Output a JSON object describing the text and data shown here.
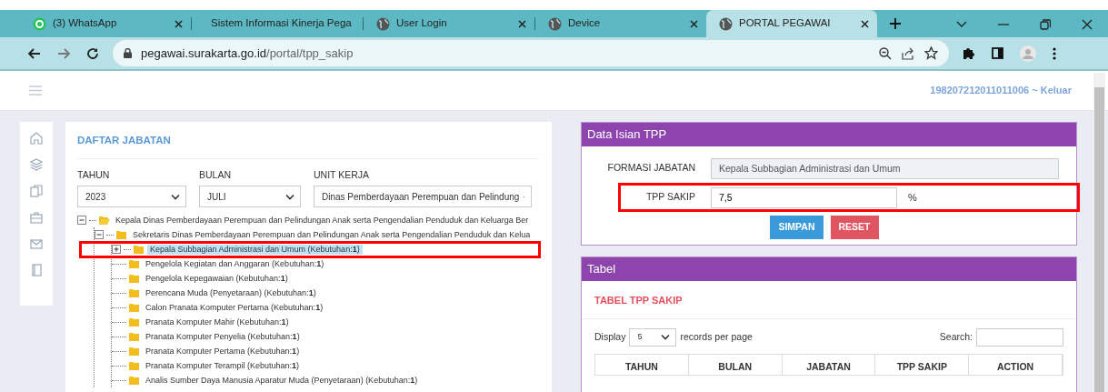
{
  "browser": {
    "tabs": [
      {
        "label": "(3) WhatsApp",
        "selected": false
      },
      {
        "label": "Sistem Informasi Kinerja Pega",
        "selected": false
      },
      {
        "label": "User Login",
        "selected": false
      },
      {
        "label": "Device",
        "selected": false
      },
      {
        "label": "PORTAL PEGAWAI",
        "selected": true
      }
    ],
    "url_host": "pegawai.surakarta.go.id",
    "url_path": "/portal/tpp_sakip"
  },
  "header": {
    "user_link": "198207212011011006 ~ Keluar"
  },
  "daftar": {
    "title": "DAFTAR JABATAN",
    "filters": [
      {
        "label": "TAHUN",
        "value": "2023"
      },
      {
        "label": "BULAN",
        "value": "JULI"
      },
      {
        "label": "UNIT KERJA",
        "value": "Dinas Pemberdayaan Perempuan dan Pelindung"
      }
    ],
    "tree": [
      {
        "label": "Kepala Dinas Pemberdayaan Perempuan dan Pelindungan Anak serta Pengendalian Penduduk dan Keluarga Ber",
        "expanded": true,
        "selected": false,
        "children": [
          {
            "label": "Sekretaris Dinas Pemberdayaan Perempuan dan Pelindungan Anak serta Pengendalian Penduduk dan Kelua",
            "expanded": true,
            "selected": false,
            "children": [
              {
                "label": "Kepala Subbagian Administrasi dan Umum (Kebutuhan:**1**)",
                "expanded": false,
                "selected": true
              },
              {
                "label": "Pengelola Kegiatan dan Anggaran (Kebutuhan:**1**)",
                "selected": false
              },
              {
                "label": "Pengelola Kepegawaian (Kebutuhan:**1**)",
                "selected": false
              },
              {
                "label": "Perencana Muda (Penyetaraan) (Kebutuhan:**1**)",
                "selected": false
              },
              {
                "label": "Calon Pranata Komputer Pertama (Kebutuhan:**1**)",
                "selected": false
              },
              {
                "label": "Pranata Komputer Mahir (Kebutuhan:**1**)",
                "selected": false
              },
              {
                "label": "Pranata Komputer Penyelia (Kebutuhan:**1**)",
                "selected": false
              },
              {
                "label": "Pranata Komputer Pertama (Kebutuhan:**1**)",
                "selected": false
              },
              {
                "label": "Pranata Komputer Terampil (Kebutuhan:**1**)",
                "selected": false
              },
              {
                "label": "Analis Sumber Daya Manusia Aparatur Muda (Penyetaraan) (Kebutuhan:**1**)",
                "selected": false
              }
            ]
          }
        ]
      }
    ]
  },
  "form": {
    "title": "Data Isian TPP",
    "fields": [
      {
        "label": "FORMASI JABATAN",
        "value": "Kepala Subbagian Administrasi dan Umum",
        "disabled": true
      },
      {
        "label": "TPP SAKIP",
        "value": "7,5",
        "unit": "%",
        "disabled": false
      }
    ],
    "buttons": [
      {
        "label": "SIMPAN",
        "kind": "primary"
      },
      {
        "label": "RESET",
        "kind": "danger"
      }
    ]
  },
  "table_panel": {
    "title": "Tabel",
    "subtitle": "TABEL TPP SAKIP",
    "display_label": "Display",
    "page_size": "5",
    "per_page_label": "records per page",
    "search_label": "Search:",
    "columns": [
      "TAHUN",
      "BULAN",
      "JABATAN",
      "TPP SAKIP",
      "ACTION"
    ]
  }
}
